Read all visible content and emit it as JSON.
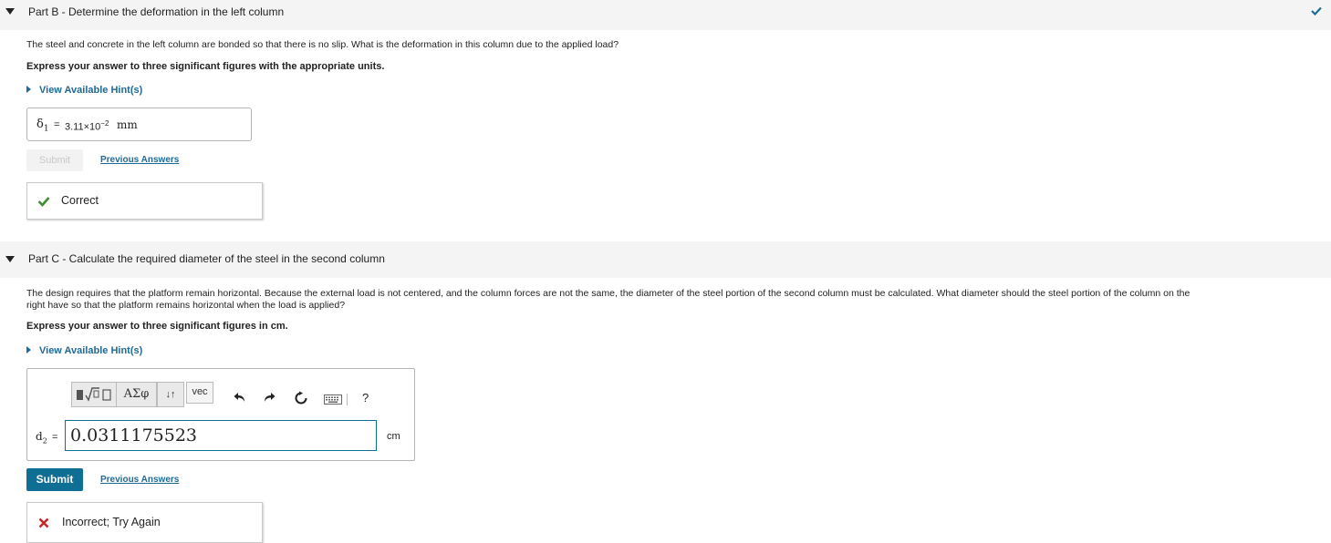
{
  "partB": {
    "title": "Part B - Determine the deformation in the left column",
    "question": "The steel and concrete in the left column are bonded so that there is no slip. What is the deformation in this column due to the applied load?",
    "instruction": "Express your answer to three significant figures with the appropriate units.",
    "hint_label": "View Available Hint(s)",
    "answer": {
      "symbol": "δ",
      "subscript": "1",
      "equals": "=",
      "mantissa": "3.11×10",
      "exponent": "−2",
      "unit": "mm"
    },
    "submit_label": "Submit",
    "previous_answers_label": "Previous Answers",
    "feedback": "Correct"
  },
  "partC": {
    "title": "Part C - Calculate the required diameter of the steel in the second column",
    "question_line1": "The design requires that the platform remain horizontal. Because the external load is not centered, and the column forces are not the same, the diameter of the steel portion of the second column must be calculated. What diameter should the steel portion of the column on the",
    "question_line2": "right have so that the platform remains horizontal when the load is applied?",
    "instruction": "Express your answer to three significant figures in cm.",
    "hint_label": "View Available Hint(s)",
    "toolbar": {
      "greek_label": "ΑΣφ",
      "arrows_label": "↓↑",
      "vec_label": "vec",
      "help_label": "?"
    },
    "answer": {
      "symbol": "d",
      "subscript": "2",
      "equals": "=",
      "value": "0.0311175523",
      "unit": "cm"
    },
    "submit_label": "Submit",
    "previous_answers_label": "Previous Answers",
    "feedback": "Incorrect; Try Again"
  },
  "colors": {
    "link": "#1e6b98",
    "submit": "#0f6e94",
    "correct": "#3c8f2f",
    "incorrect": "#c62828"
  }
}
